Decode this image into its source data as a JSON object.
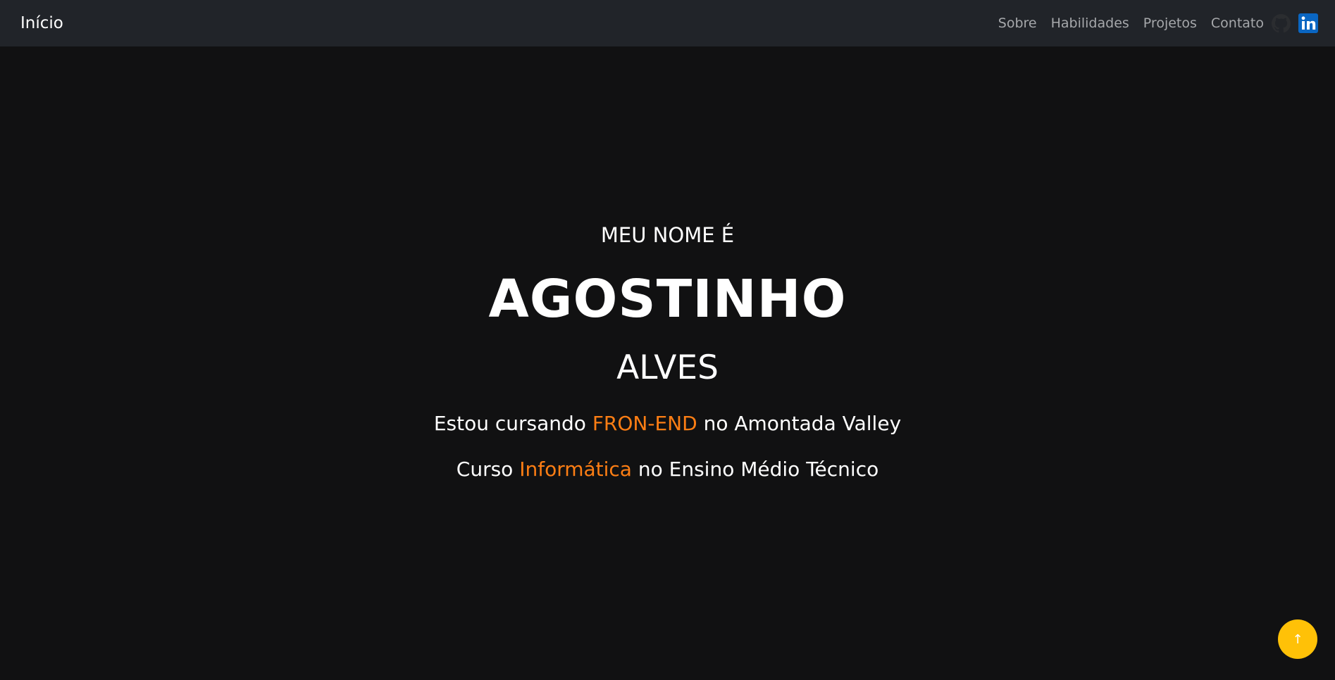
{
  "nav": {
    "brand": "Início",
    "links": [
      "Sobre",
      "Habilidades",
      "Projetos",
      "Contato"
    ],
    "social": [
      {
        "icon": "github-icon",
        "color": "#2b2d30"
      },
      {
        "icon": "linkedin-icon",
        "color": "#0a66c2"
      }
    ]
  },
  "hero": {
    "intro": "MEU NOME É",
    "first_name": "AGOSTINHO",
    "last_name": "ALVES",
    "line1": {
      "before": "Estou cursando ",
      "highlight": "FRON-END",
      "after": " no Amontada Valley"
    },
    "line2": {
      "before": "Curso ",
      "highlight": "Informática",
      "after": " no Ensino Médio Técnico"
    }
  },
  "back_to_top": {
    "label": "↑",
    "color": "#ffc107"
  },
  "colors": {
    "background": "#111112",
    "navbar": "#212429",
    "accent": "#fd7e14",
    "nav_link": "#a6a8ab"
  }
}
